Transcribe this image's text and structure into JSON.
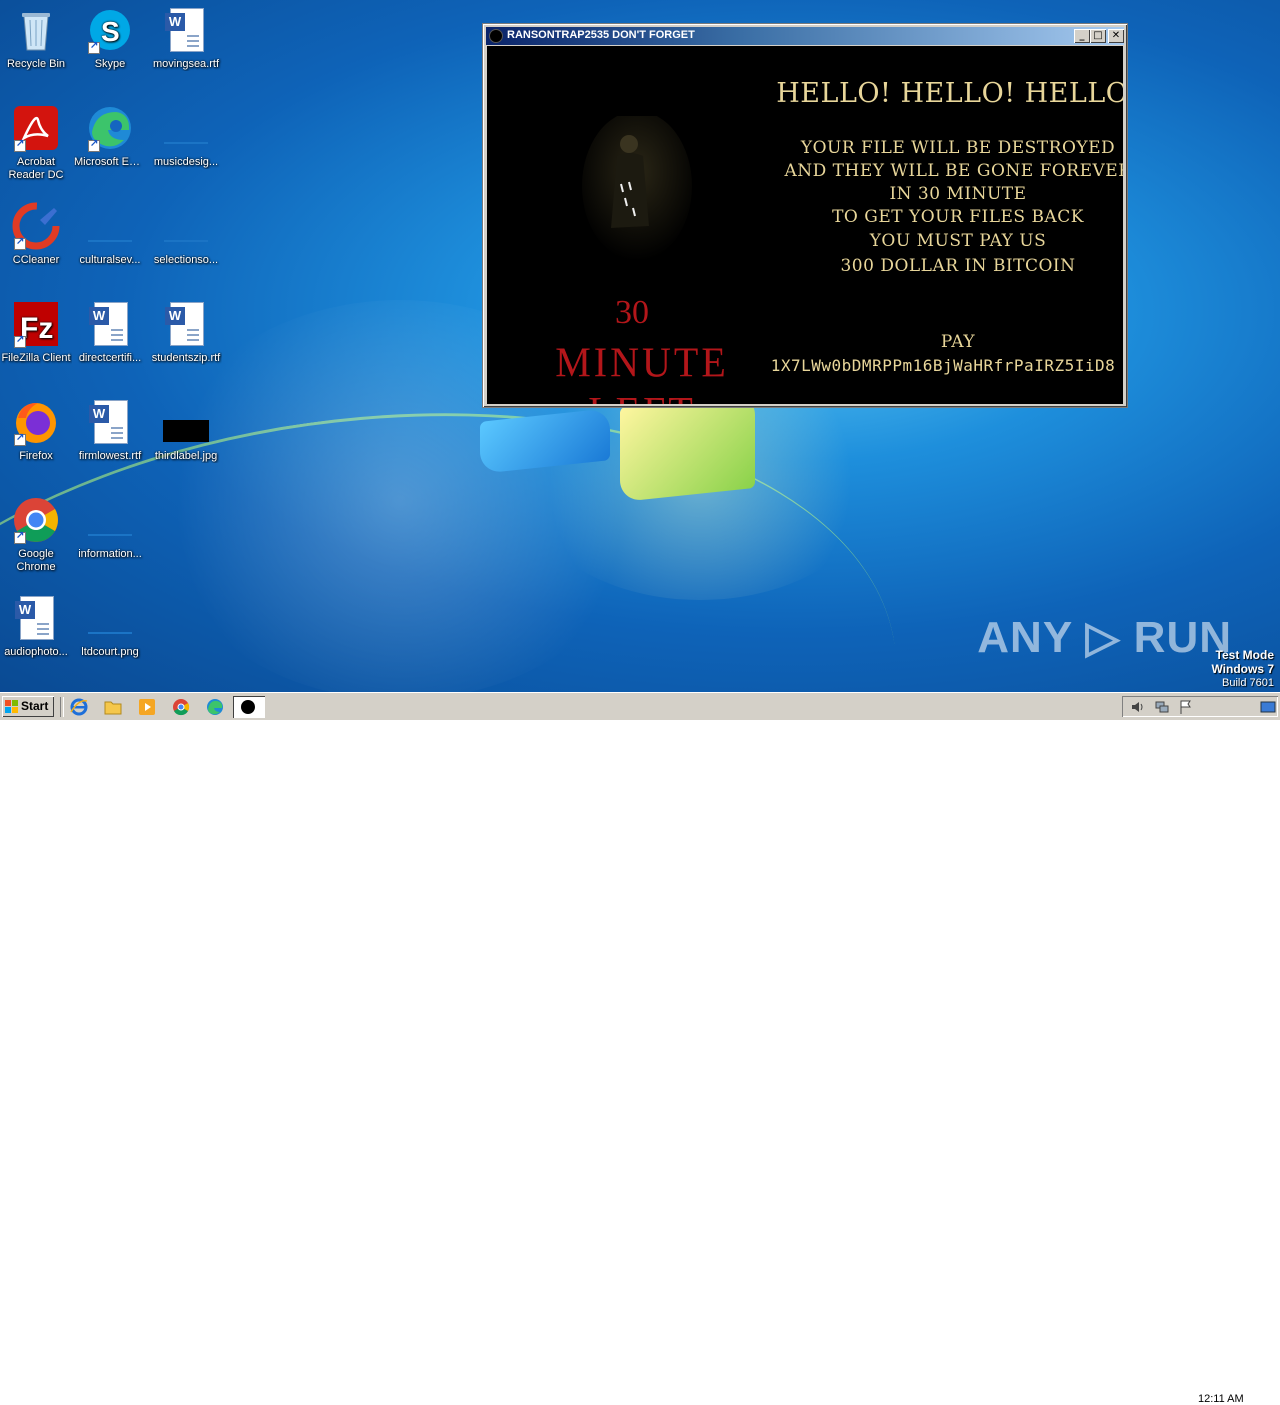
{
  "desktop_icons": [
    {
      "label": "Recycle Bin",
      "icon": "recycle-bin-icon"
    },
    {
      "label": "Skype",
      "icon": "skype-icon"
    },
    {
      "label": "movingsea.rtf",
      "icon": "word-document-icon"
    },
    {
      "label": "Acrobat Reader DC",
      "icon": "acrobat-reader-icon"
    },
    {
      "label": "Microsoft Edge",
      "icon": "edge-icon"
    },
    {
      "label": "musicdesig...",
      "icon": "blank-file-icon"
    },
    {
      "label": "CCleaner",
      "icon": "ccleaner-icon"
    },
    {
      "label": "culturalsev...",
      "icon": "blank-file-icon"
    },
    {
      "label": "selectionso...",
      "icon": "blank-file-icon"
    },
    {
      "label": "FileZilla Client",
      "icon": "filezilla-icon"
    },
    {
      "label": "directcertifi...",
      "icon": "word-document-icon"
    },
    {
      "label": "studentszip.rtf",
      "icon": "word-document-icon"
    },
    {
      "label": "Firefox",
      "icon": "firefox-icon"
    },
    {
      "label": "firmlowest.rtf",
      "icon": "word-document-icon"
    },
    {
      "label": "thirdlabel.jpg",
      "icon": "image-file-icon"
    },
    {
      "label": "Google Chrome",
      "icon": "chrome-icon"
    },
    {
      "label": "information...",
      "icon": "blank-file-icon"
    },
    {
      "label": "audiophoto...",
      "icon": "word-document-icon"
    },
    {
      "label": "ltdcourt.png",
      "icon": "blank-file-icon"
    }
  ],
  "window": {
    "title": "RANSONTRAP2535 DON'T FORGET",
    "minimize": "_",
    "maximize": "□",
    "close": "✕",
    "headline": "HELLO!  HELLO!  HELLO!",
    "message_lines": [
      "YOUR FILE WILL BE DESTROYED",
      "AND THEY WILL BE GONE FOREVER",
      "IN 30 MINUTE",
      "TO GET YOUR FILES BACK",
      "YOU MUST PAY US",
      "300 DOLLAR IN BITCOIN"
    ],
    "countdown_number": "30",
    "countdown_label": "MINUTE LEFT",
    "pay_label": "PAY",
    "bitcoin_address": "1X7LWw0bDMRPPm16BjWaHRfrPaIRZ5IiD8",
    "accent_red": "#b3161a",
    "accent_gold": "#e8d69a"
  },
  "watermark": "ANY ▷ RUN",
  "os_info": {
    "line1": "Test Mode",
    "line2": "Windows 7",
    "line3": "Build 7601"
  },
  "taskbar": {
    "start_label": "Start",
    "quick_launch": [
      "internet-explorer-icon",
      "explorer-folder-icon",
      "media-player-icon",
      "chrome-icon",
      "edge-icon"
    ],
    "clock": "12:11 AM"
  }
}
